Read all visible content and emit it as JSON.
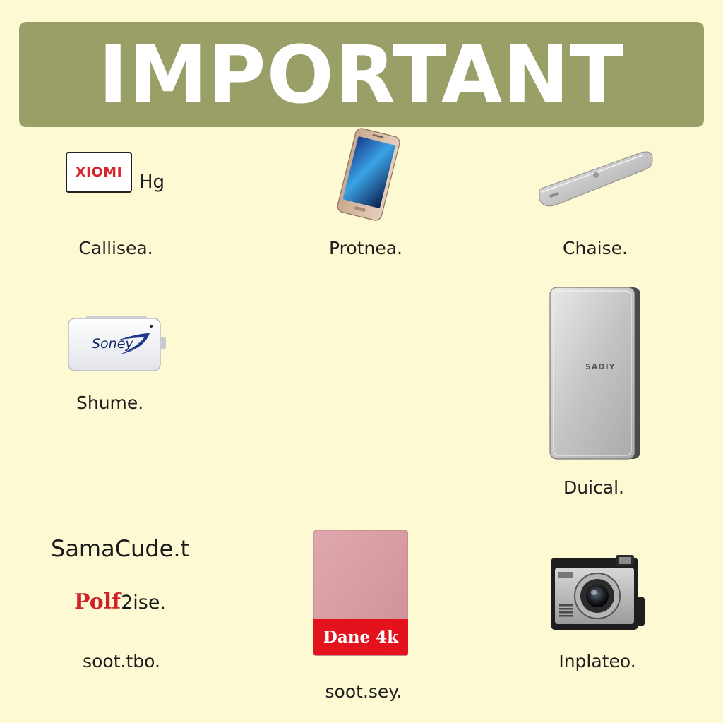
{
  "banner": {
    "title": "IMPORTANT"
  },
  "logos": {
    "xiaomi": "XIOMI",
    "hg": "Hg",
    "soney": "Soney",
    "samacude": "SamaCude.t",
    "polf_red": "Polf",
    "polf_rest": "2ise.",
    "dane": "Dane 4k",
    "sadiy": "SADIY"
  },
  "captions": {
    "top_left": "Callisea.",
    "top_center": "Protnea.",
    "top_right": "Chaise.",
    "mid_left": "Shume.",
    "mid_right": "Duical.",
    "bottom_left": "soot.tbo.",
    "bottom_center": "soot.sey.",
    "bottom_right": "Inplateo."
  },
  "colors": {
    "background": "#fdf9d2",
    "banner": "#9a9f68",
    "accent_red": "#e3121d",
    "pink_case": "#d79ea3"
  },
  "icons": [
    "smartphone-icon",
    "silver-phone-icon",
    "usb-drive-icon",
    "silver-tablet-icon",
    "pink-case-icon",
    "camera-icon"
  ]
}
